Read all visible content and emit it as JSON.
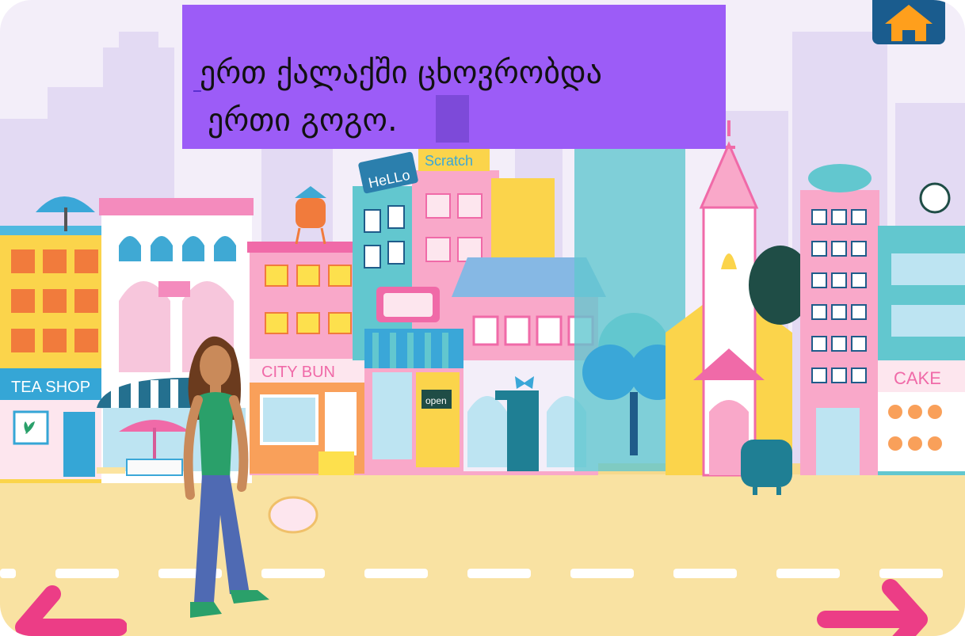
{
  "story": {
    "caption_lines": [
      "ერთ ქალაქში ცხოვრობდა",
      "ერთი გოგო."
    ]
  },
  "signs": {
    "tea_shop": "TEA SHOP",
    "city_bun": "CITY BUN",
    "cake": "CAKE",
    "hello": "HeLLo",
    "scratch": "Scratch",
    "open": "open"
  },
  "icons": {
    "home": "home-icon",
    "previous": "arrow-left-icon",
    "next": "arrow-right-icon"
  },
  "colors": {
    "caption_bg": "#9c5cf7",
    "home_bg": "#1a5c8e",
    "home_house": "#ff9f1c",
    "arrow": "#ec3d86",
    "street": "#f9e2a2",
    "sky": "#f1ecf8"
  }
}
